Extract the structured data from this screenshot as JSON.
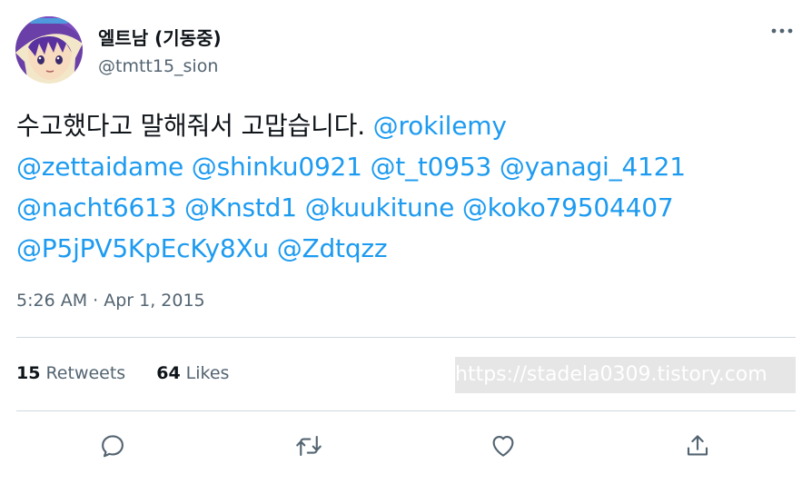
{
  "author": {
    "display_name": "엘트남 (기동중)",
    "handle": "@tmtt15_sion",
    "avatar_icon": "anime-character-avatar"
  },
  "tweet": {
    "text_prefix": "수고했다고 말해줘서 고맙습니다.",
    "mentions": [
      "@rokilemy",
      "@zettaidame",
      "@shinku0921",
      "@t_t0953",
      "@yanagi_4121",
      "@nacht6613",
      "@Knstd1",
      "@kuukitune",
      "@koko79504407",
      "@P5jPV5KpEcKy8Xu",
      "@Zdtqzz"
    ],
    "timestamp": "5:26 AM · Apr 1, 2015"
  },
  "stats": {
    "retweets_count": "15",
    "retweets_label": "Retweets",
    "likes_count": "64",
    "likes_label": "Likes"
  },
  "watermark": "https://stadela0309.tistory.com",
  "actions": [
    {
      "name": "reply",
      "icon": "reply-icon"
    },
    {
      "name": "retweet",
      "icon": "retweet-icon"
    },
    {
      "name": "like",
      "icon": "heart-icon"
    },
    {
      "name": "share",
      "icon": "share-icon"
    }
  ],
  "colors": {
    "text": "#0f1419",
    "secondary": "#536471",
    "link": "#1d9bf0",
    "divider": "#cfd9de",
    "watermark_bg": "#e6e6e6"
  }
}
